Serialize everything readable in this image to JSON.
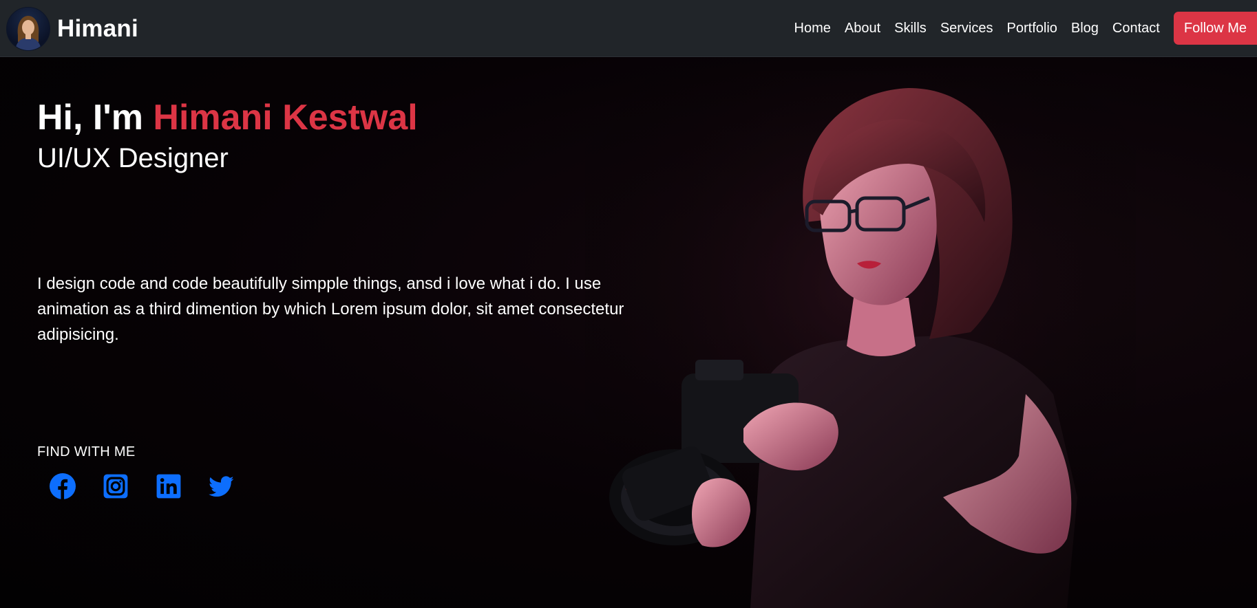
{
  "brand": {
    "name": "Himani"
  },
  "nav": {
    "links": [
      "Home",
      "About",
      "Skills",
      "Services",
      "Portfolio",
      "Blog",
      "Contact"
    ],
    "follow_label": "Follow Me"
  },
  "hero": {
    "greeting_prefix": "Hi, I'm ",
    "name": "Himani Kestwal",
    "role": "UI/UX Designer",
    "bio": "I design code and code beautifully simpple things, ansd i love what i do. I use animation as a third dimention by which Lorem ipsum dolor, sit amet consectetur adipisicing.",
    "find_label": "FIND WITH ME"
  },
  "socials": [
    "facebook-icon",
    "instagram-icon",
    "linkedin-icon",
    "twitter-icon"
  ],
  "colors": {
    "navbar": "#212529",
    "accent": "#dc3545",
    "social_icons": "#0d6efd",
    "background": "#000000"
  }
}
